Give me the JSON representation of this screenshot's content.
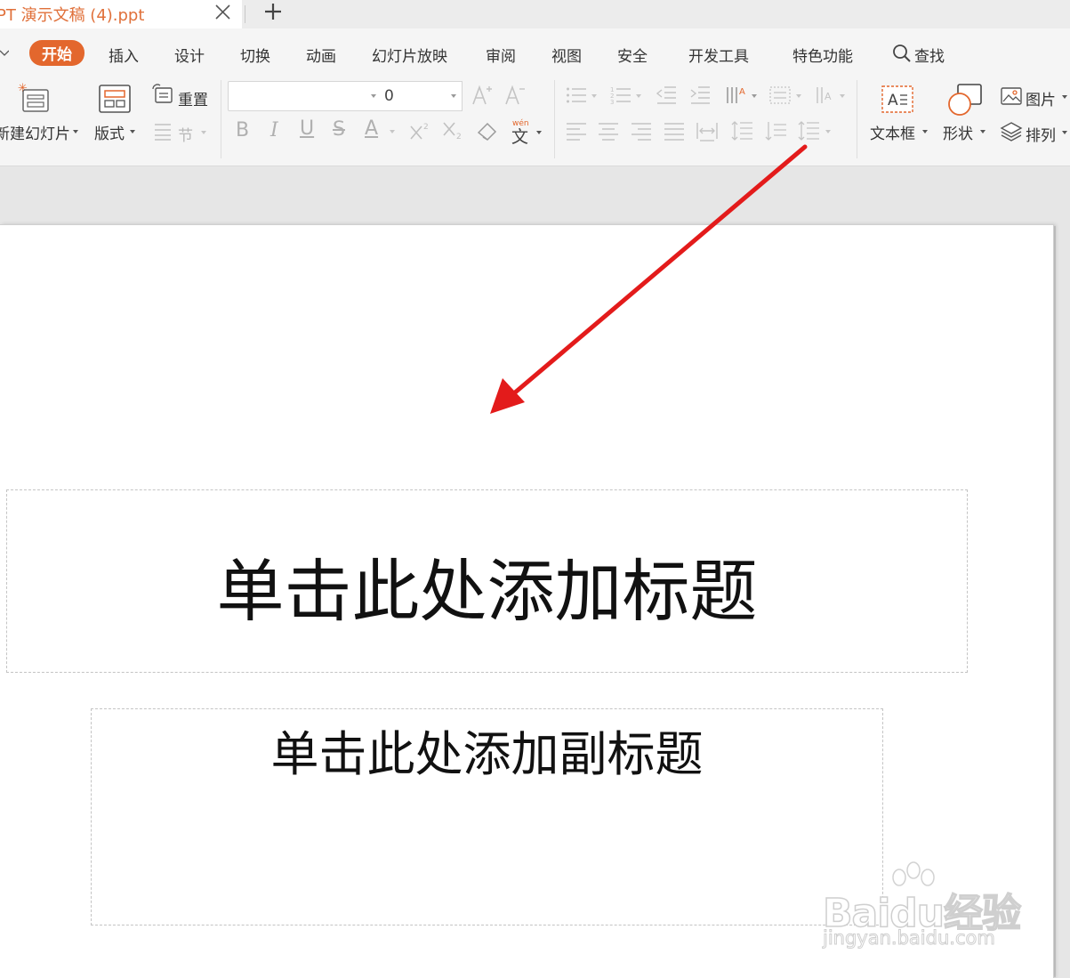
{
  "tab": {
    "title": "PT 演示文稿 (4).ppt"
  },
  "menu": {
    "items": [
      "开始",
      "插入",
      "设计",
      "切换",
      "动画",
      "幻灯片放映",
      "审阅",
      "视图",
      "安全",
      "开发工具",
      "特色功能"
    ],
    "active_index": 0,
    "search_label": "查找"
  },
  "ribbon": {
    "new_slide_label": "新建幻灯片",
    "layout_label": "版式",
    "reset_label": "重置",
    "section_label": "节",
    "font_name": "",
    "font_size": "0",
    "text_box_label": "文本框",
    "shape_label": "形状",
    "picture_label": "图片",
    "arrange_label": "排列"
  },
  "slide": {
    "title_placeholder": "单击此处添加标题",
    "subtitle_placeholder": "单击此处添加副标题"
  },
  "annotation": {
    "arrow_color": "#e31b1b"
  },
  "watermark": {
    "logo": "Baidu经验",
    "url": "jingyan.baidu.com"
  },
  "colors": {
    "accent": "#e3672d",
    "tab_text": "#e0703a"
  }
}
